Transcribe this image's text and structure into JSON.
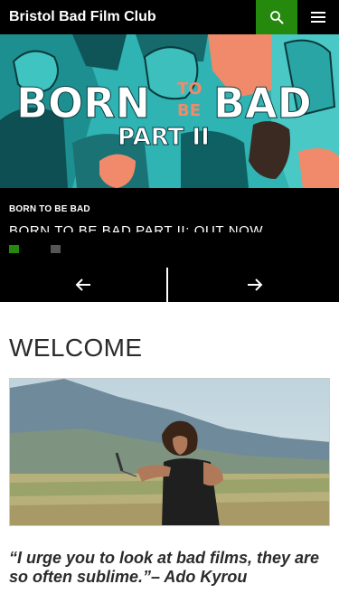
{
  "header": {
    "site_title": "Bristol Bad Film Club",
    "search_icon": "search-icon",
    "menu_icon": "hamburger-menu-icon"
  },
  "slider": {
    "poster_text": {
      "line1_a": "BORN",
      "line1_b": "TO",
      "line1_c": "BE",
      "line1_d": "BAD",
      "line2": "PART II"
    },
    "kicker": "BORN TO BE BAD",
    "title": "BORN TO BE BAD PART II: OUT NOW",
    "dots": 2,
    "active_dot": 1
  },
  "slider_nav": {
    "prev_icon": "arrow-left-icon",
    "next_icon": "arrow-right-icon"
  },
  "content": {
    "heading": "WELCOME",
    "quote": "“I urge you to look at bad films, they are so often sublime.”– Ado Kyrou"
  },
  "colors": {
    "accent": "#24890d",
    "header_bg": "#000000",
    "poster_teal": "#2fb3b3",
    "poster_salmon": "#f08a6a"
  }
}
